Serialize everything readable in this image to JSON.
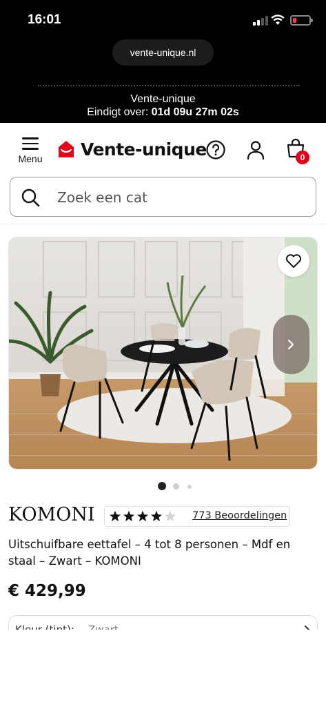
{
  "status_bar": {
    "time": "16:01",
    "url": "vente-unique.nl"
  },
  "promo": {
    "brand": "Vente-unique",
    "countdown_label": "Eindigt over:",
    "countdown_value": "01d 09u 27m 02s"
  },
  "header": {
    "menu_label": "Menu",
    "logo_text": "Vente-unique",
    "cart_count": "0",
    "icons": [
      "menu-icon",
      "logo-icon",
      "help-icon",
      "account-icon",
      "cart-icon"
    ]
  },
  "search": {
    "placeholder": "Zoek een cat"
  },
  "gallery": {
    "image_alt": "product-photo",
    "slide_count": 3,
    "active_slide": 1
  },
  "product": {
    "brand": "KOMONI",
    "rating": 4.5,
    "rating_max": 5,
    "reviews_label": "773 Beoordelingen",
    "title": "Uitschuifbare eettafel – 4 tot 8 personen – Mdf en staal – Zwart – KOMONI",
    "price": "€ 429,99",
    "variant_label": "Kleur (tint):",
    "variant_value": "Zwart"
  },
  "colors": {
    "brand_red": "#e2001a",
    "text": "#111111",
    "border": "#dcdcdc"
  }
}
